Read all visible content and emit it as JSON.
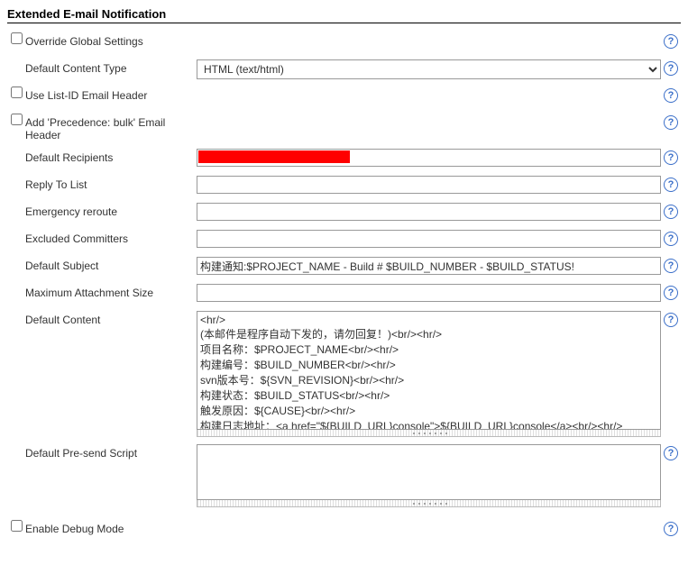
{
  "section_title": "Extended E-mail Notification",
  "override_global": {
    "label": "Override Global Settings",
    "checked": false
  },
  "content_type": {
    "label": "Default Content Type",
    "value": "HTML (text/html)"
  },
  "use_list_id": {
    "label": "Use List-ID Email Header",
    "checked": false
  },
  "precedence_bulk": {
    "label": "Add 'Precedence: bulk' Email Header",
    "checked": false
  },
  "default_recipients": {
    "label": "Default Recipients",
    "value": ""
  },
  "reply_to_list": {
    "label": "Reply To List",
    "value": ""
  },
  "emergency_reroute": {
    "label": "Emergency reroute",
    "value": ""
  },
  "excluded_committers": {
    "label": "Excluded Committers",
    "value": ""
  },
  "default_subject": {
    "label": "Default Subject",
    "value": "构建通知:$PROJECT_NAME - Build # $BUILD_NUMBER - $BUILD_STATUS!"
  },
  "max_attachment": {
    "label": "Maximum Attachment Size",
    "value": ""
  },
  "default_content": {
    "label": "Default Content",
    "value": "<hr/>\n(本邮件是程序自动下发的，请勿回复！)<br/><hr/>\n项目名称：$PROJECT_NAME<br/><hr/>\n构建编号：$BUILD_NUMBER<br/><hr/>\nsvn版本号：${SVN_REVISION}<br/><hr/>\n构建状态：$BUILD_STATUS<br/><hr/>\n触发原因：${CAUSE}<br/><hr/>\n构建日志地址：<a href=\"${BUILD_URL}console\">${BUILD_URL}console</a><br/><hr/>\n构建地址：<a href=\"$BUILD_URL\">$BUILD_URL</a><br/><hr/>"
  },
  "presend_script": {
    "label": "Default Pre-send Script",
    "value": ""
  },
  "enable_debug": {
    "label": "Enable Debug Mode",
    "checked": false
  }
}
